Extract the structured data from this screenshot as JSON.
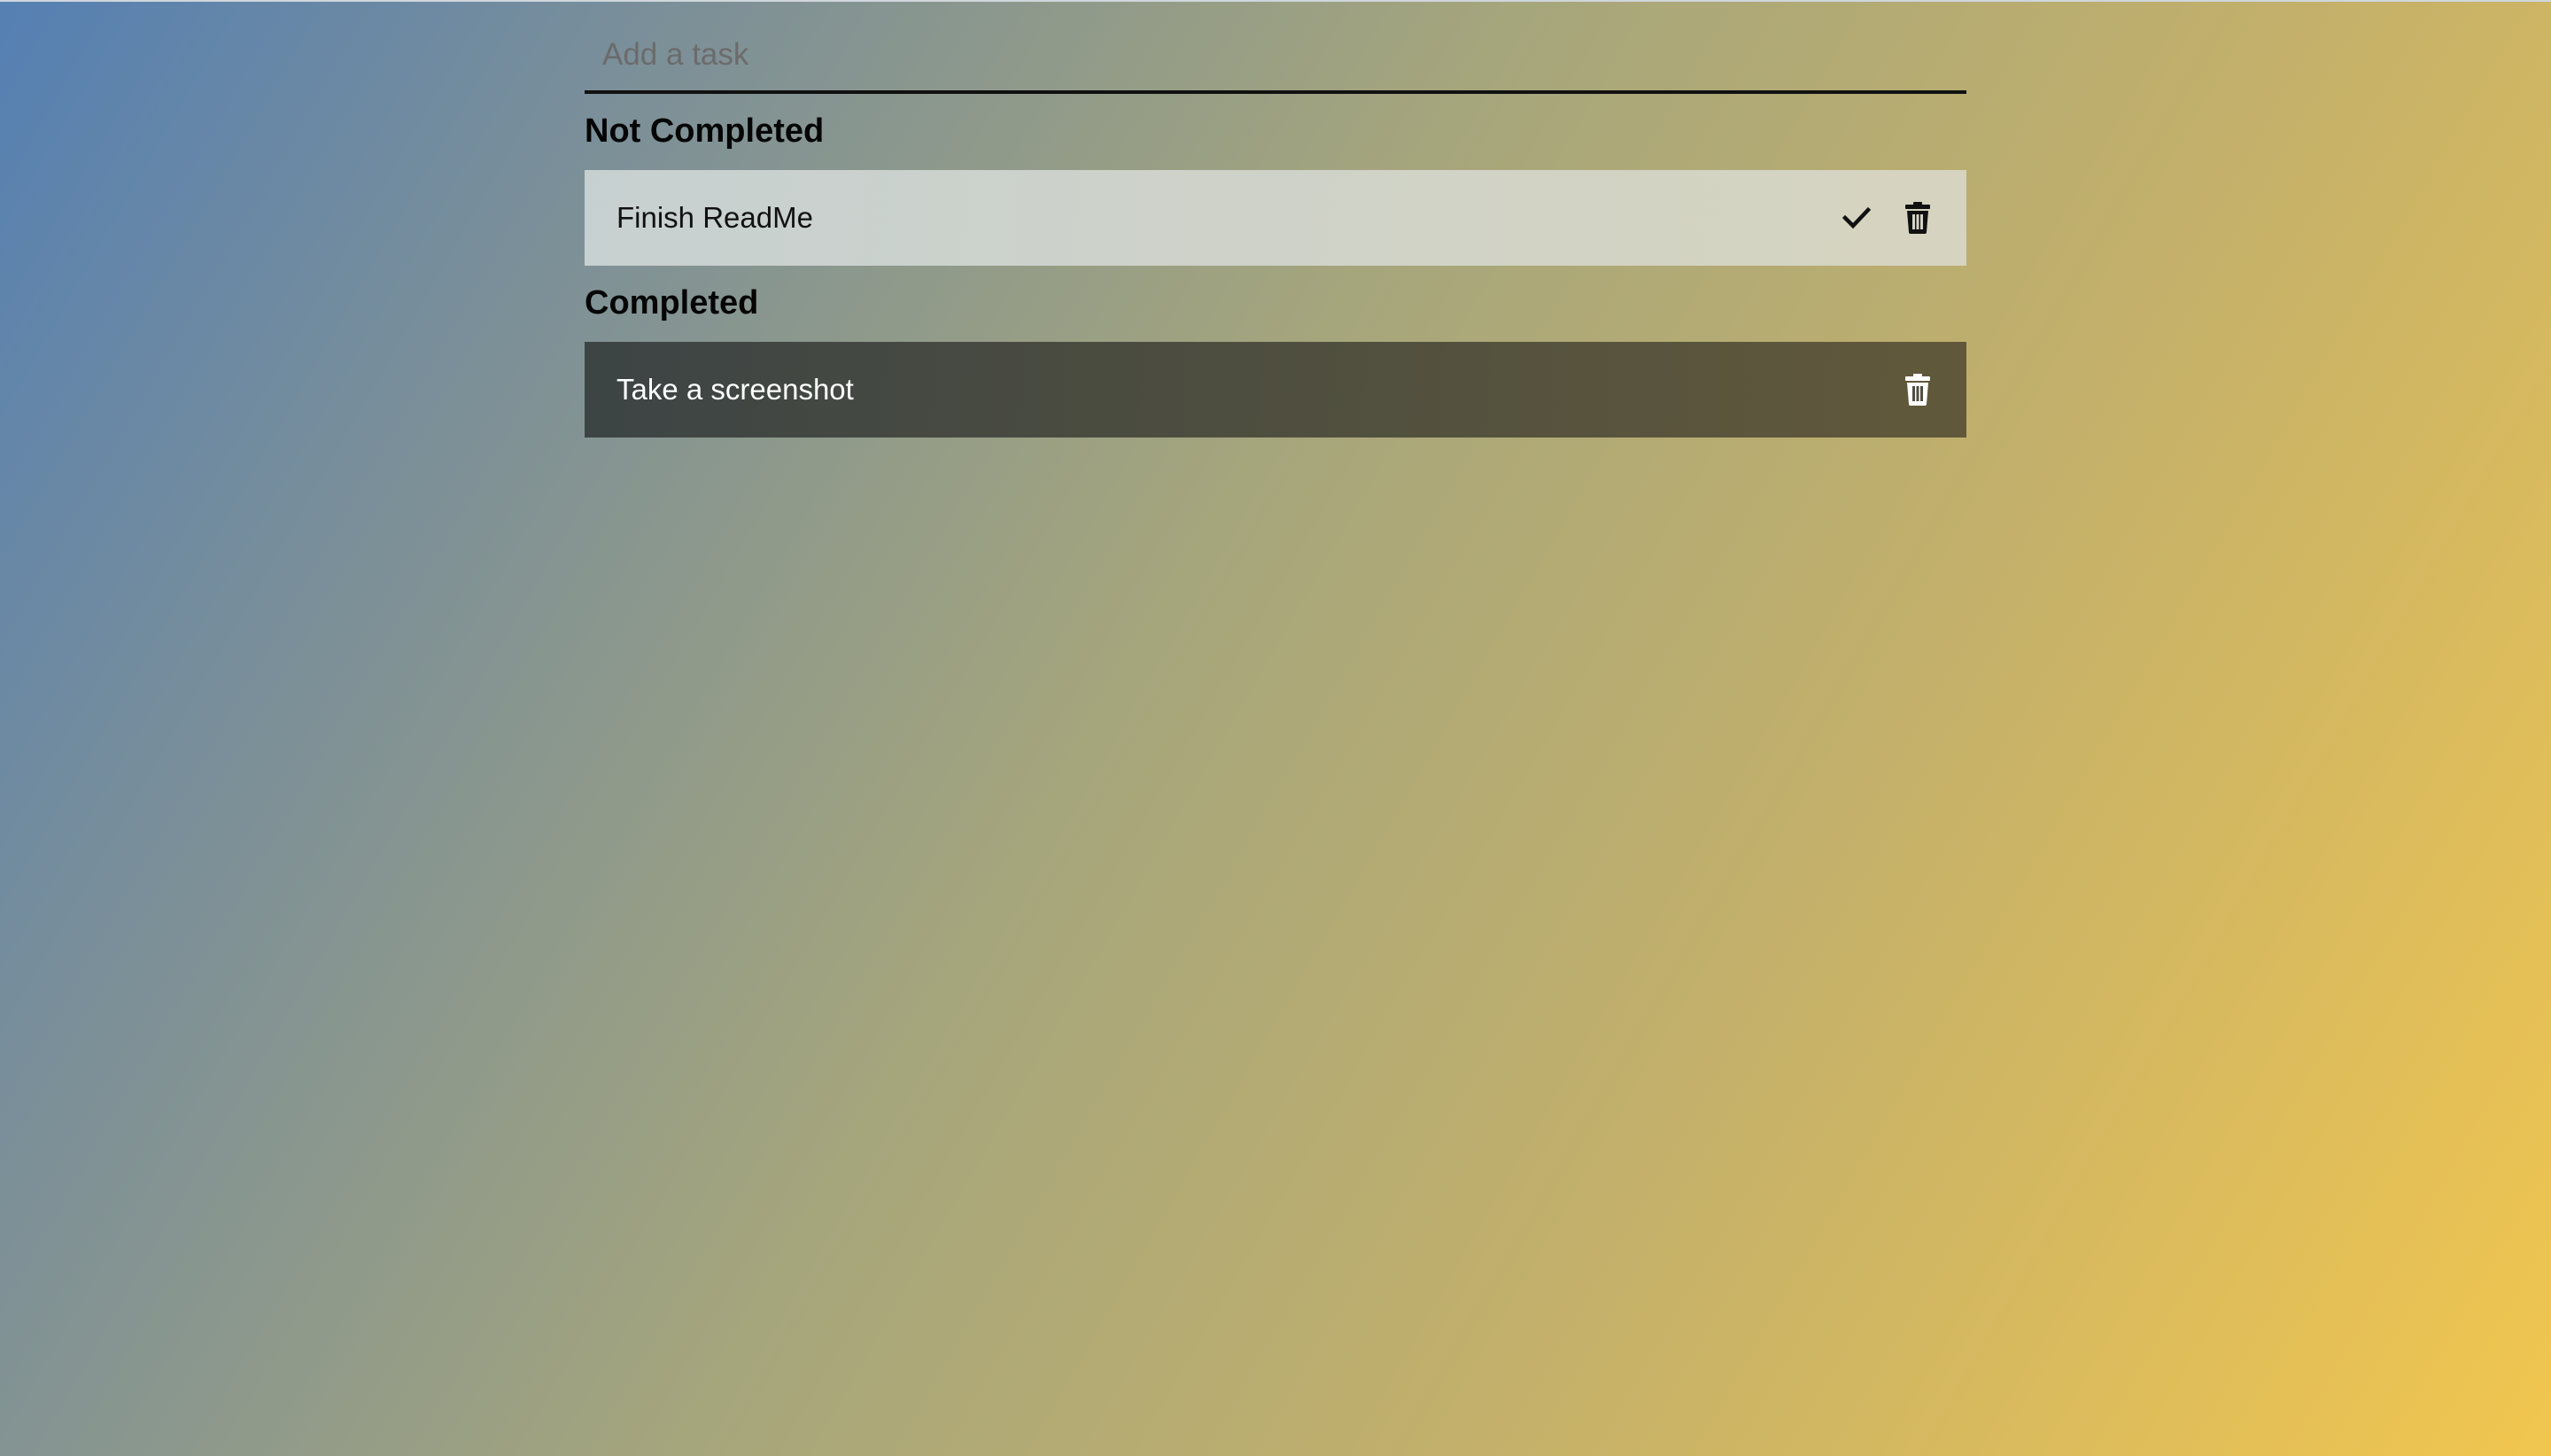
{
  "input": {
    "placeholder": "Add a task",
    "value": ""
  },
  "sections": {
    "not_completed": {
      "heading": "Not Completed",
      "tasks": [
        {
          "text": "Finish ReadMe",
          "icons": [
            "check-icon",
            "trash-icon"
          ]
        }
      ]
    },
    "completed": {
      "heading": "Completed",
      "tasks": [
        {
          "text": "Take a screenshot",
          "icons": [
            "trash-icon"
          ]
        }
      ]
    }
  },
  "colors": {
    "gradient_start": "#5580b3",
    "gradient_end": "#f1c64f",
    "pending_row": "#d2d4c8",
    "done_row": "#454743"
  }
}
